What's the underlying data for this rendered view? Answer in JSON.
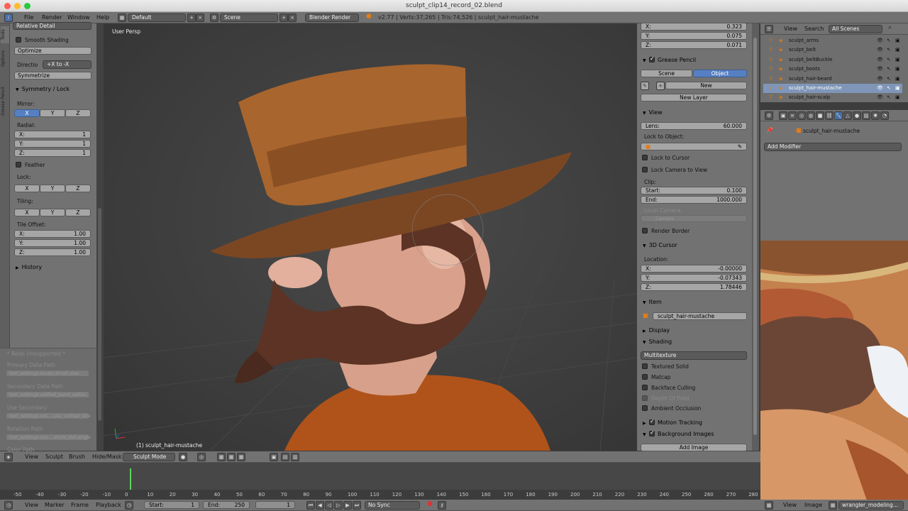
{
  "window": {
    "title": "sculpt_clip14_record_02.blend"
  },
  "info_header": {
    "menus": [
      "File",
      "Render",
      "Window",
      "Help"
    ],
    "layout": "Default",
    "scene": "Scene",
    "engine": "Blender Render",
    "stats": "v2.77 | Verts:37,265 | Tris:74,526 | sculpt_hair-mustache"
  },
  "tool_shelf": {
    "tabs": [
      "Tools",
      "Options",
      "Grease Pencil"
    ],
    "relative_detail": "Relative Detail",
    "smooth_shading": "Smooth Shading",
    "optimize": "Optimize",
    "direction_label": "Directio",
    "direction_value": "+X to -X",
    "symmetrize": "Symmetrize",
    "symmetry_title": "Symmetry / Lock",
    "mirror_label": "Mirror:",
    "radial_label": "Radial:",
    "feather": "Feather",
    "lock_label": "Lock:",
    "tiling_label": "Tiling:",
    "tile_offset_label": "Tile Offset:",
    "axes": [
      "X",
      "Y",
      "Z"
    ],
    "radial": [
      {
        "k": "X:",
        "v": "1"
      },
      {
        "k": "Y:",
        "v": "1"
      },
      {
        "k": "Z:",
        "v": "1"
      }
    ],
    "tile_offset": [
      {
        "k": "X:",
        "v": "1.00"
      },
      {
        "k": "Y:",
        "v": "1.00"
      },
      {
        "k": "Z:",
        "v": "1.00"
      }
    ],
    "history": "History"
  },
  "operator_panel": {
    "title": "* Redo Unsupported *",
    "rows": [
      {
        "label": "Primary Data Path",
        "value": "tool_settings.sculpt.brush.size"
      },
      {
        "label": "Secondary Data Path",
        "value": "tool_settings.unified_paint_settin..."
      },
      {
        "label": "Use Secondary",
        "value": "tool_settings.uni....use_unified_size"
      },
      {
        "label": "Rotation Path",
        "value": "tool_settings.scu....xture_slot.angle"
      },
      {
        "label": "Color Path",
        "value": ""
      }
    ]
  },
  "viewport": {
    "view_name": "User Persp",
    "object_label": "(1) sculpt_hair-mustache"
  },
  "view3d_header": {
    "menus": [
      "View",
      "Sculpt",
      "Brush",
      "Hide/Mask"
    ],
    "mode": "Sculpt Mode"
  },
  "properties_n": {
    "top_xyz": [
      {
        "k": "X:",
        "v": "0.323"
      },
      {
        "k": "Y:",
        "v": "0.075"
      },
      {
        "k": "Z:",
        "v": "0.071"
      }
    ],
    "grease_pencil": "Grease Pencil",
    "gp_scene": "Scene",
    "gp_object": "Object",
    "gp_new": "New",
    "gp_new_layer": "New Layer",
    "view_title": "View",
    "lens_label": "Lens:",
    "lens_value": "60.000",
    "lock_to_object": "Lock to Object:",
    "lock_to_cursor": "Lock to Cursor",
    "lock_camera": "Lock Camera to View",
    "clip_label": "Clip:",
    "clip_start_label": "Start:",
    "clip_start": "0.100",
    "clip_end_label": "End:",
    "clip_end": "1000.000",
    "local_camera": "Local Camera:",
    "camera": "Camera",
    "render_border": "Render Border",
    "cursor_title": "3D Cursor",
    "location": "Location:",
    "cursor": [
      {
        "k": "X:",
        "v": "-0.00000"
      },
      {
        "k": "Y:",
        "v": "-0.07343"
      },
      {
        "k": "Z:",
        "v": "1.78446"
      }
    ],
    "item_title": "Item",
    "item_name": "sculpt_hair-mustache",
    "display_title": "Display",
    "shading_title": "Shading",
    "shading_mode": "Multitexture",
    "textured_solid": "Textured Solid",
    "matcap": "Matcap",
    "backface": "Backface Culling",
    "depth_of_field": "Depth Of Field",
    "ambient_occlusion": "Ambient Occlusion",
    "motion_tracking": "Motion Tracking",
    "background_images": "Background Images",
    "add_image": "Add Image"
  },
  "outliner": {
    "menus": [
      "View",
      "Search"
    ],
    "scope": "All Scenes",
    "items": [
      "sculpt_arms",
      "sculpt_belt",
      "sculpt_beltBuckle",
      "sculpt_boots",
      "sculpt_hair-beard",
      "sculpt_hair-mustache",
      "sculpt_hair-scalp"
    ],
    "selected_index": 5
  },
  "modifiers": {
    "object": "sculpt_hair-mustache",
    "add_modifier": "Add Modifier"
  },
  "timeline": {
    "menus": [
      "View",
      "Marker",
      "Frame",
      "Playback"
    ],
    "start_label": "Start:",
    "start": "1",
    "end_label": "End:",
    "end": "250",
    "current": "1",
    "sync": "No Sync",
    "ruler": [
      "-50",
      "-40",
      "-30",
      "-20",
      "-10",
      "0",
      "10",
      "20",
      "30",
      "40",
      "50",
      "60",
      "70",
      "80",
      "90",
      "100",
      "110",
      "120",
      "130",
      "140",
      "150",
      "160",
      "170",
      "180",
      "190",
      "200",
      "210",
      "220",
      "230",
      "240",
      "250",
      "260",
      "270",
      "280"
    ]
  },
  "image_editor": {
    "menus": [
      "View",
      "Image"
    ],
    "image_name": "wrangler_modeling..."
  }
}
